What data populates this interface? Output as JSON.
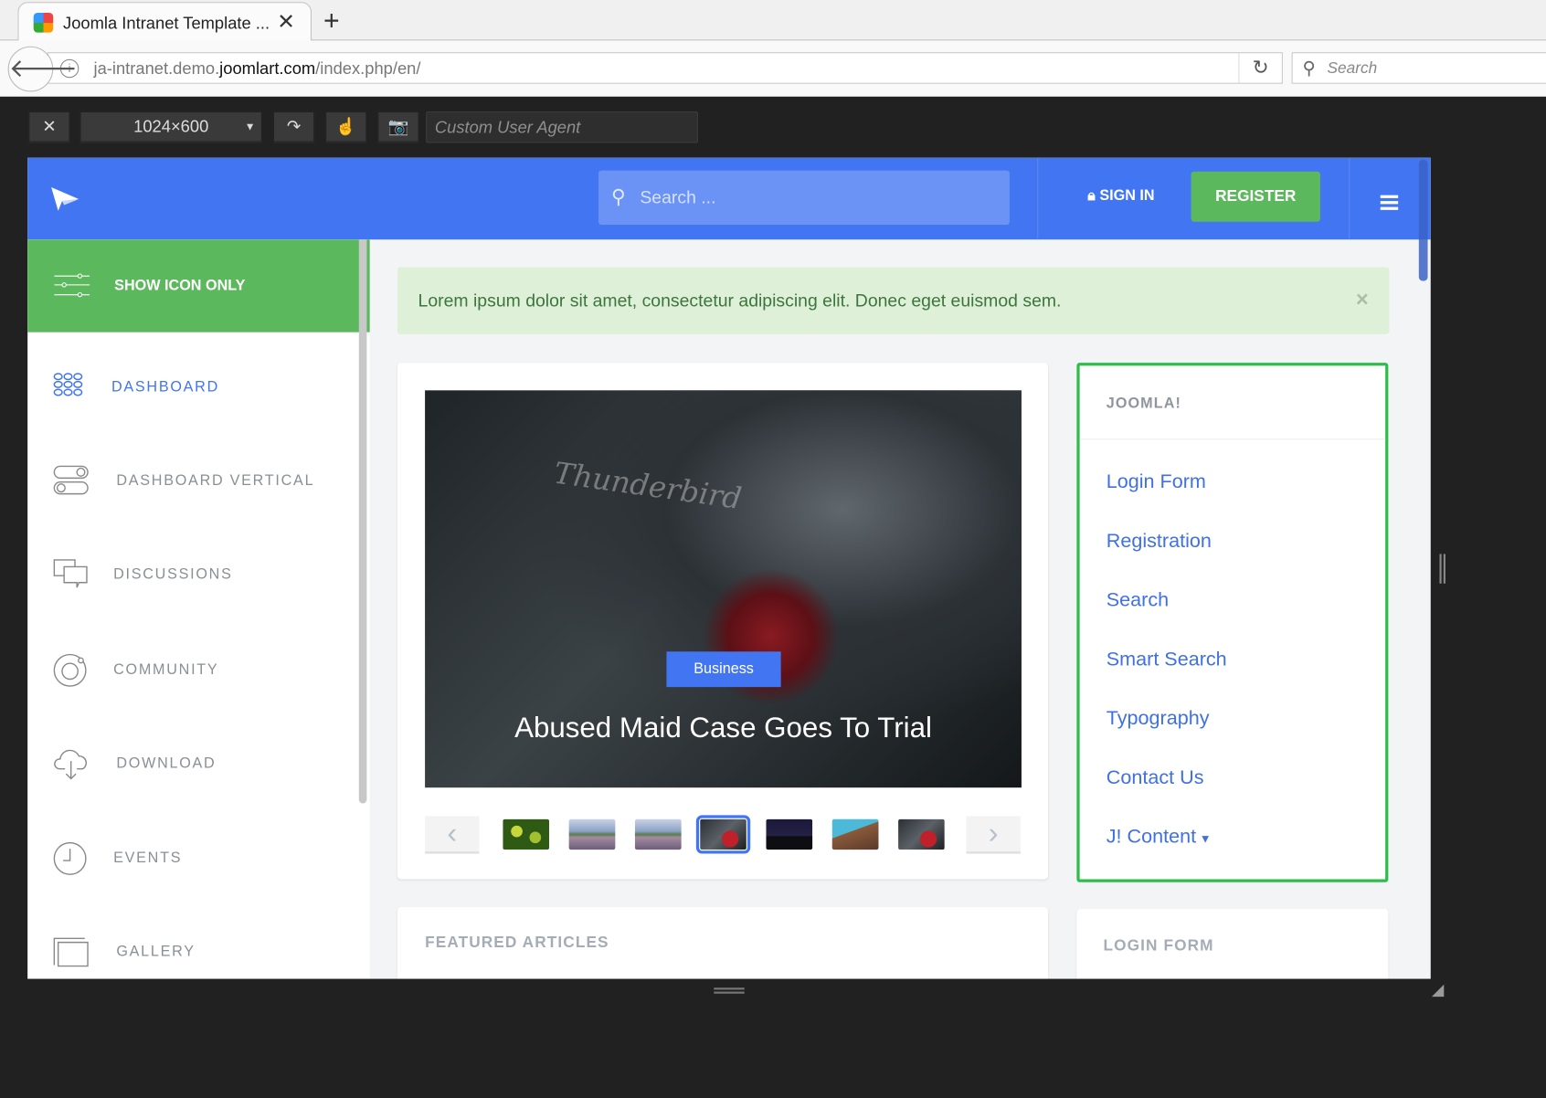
{
  "browser": {
    "tab_title": "Joomla Intranet Template ...",
    "url_host_prefix": "ja-intranet.demo.",
    "url_domain": "joomlart.com",
    "url_path": "/index.php/en/",
    "search_placeholder": "Search"
  },
  "devtools": {
    "viewport": "1024×600",
    "user_agent_placeholder": "Custom User Agent"
  },
  "header": {
    "search_placeholder": "Search ...",
    "sign_in": "SIGN IN",
    "register": "REGISTER"
  },
  "sidebar": {
    "toggle": "SHOW ICON ONLY",
    "items": [
      {
        "label": "DASHBOARD",
        "icon": "grid-icon",
        "active": true
      },
      {
        "label": "DASHBOARD VERTICAL",
        "icon": "toggles-icon"
      },
      {
        "label": "DISCUSSIONS",
        "icon": "chat-icon"
      },
      {
        "label": "COMMUNITY",
        "icon": "orbit-icon"
      },
      {
        "label": "DOWNLOAD",
        "icon": "cloud-download-icon"
      },
      {
        "label": "EVENTS",
        "icon": "clock-icon"
      },
      {
        "label": "GALLERY",
        "icon": "gallery-icon"
      }
    ]
  },
  "alert": {
    "text": "Lorem ipsum dolor sit amet, consectetur adipiscing elit. Donec eget euismod sem.",
    "close": "×"
  },
  "slider": {
    "category": "Business",
    "title": "Abused Maid Case Goes To Trial",
    "image_script": "Thunderbird",
    "selected_index": 3,
    "thumb_count": 7
  },
  "joomla_panel": {
    "heading": "JOOMLA!",
    "links": [
      "Login Form",
      "Registration",
      "Search",
      "Smart Search",
      "Typography",
      "Contact Us",
      "J! Content"
    ]
  },
  "featured": {
    "heading": "FEATURED ARTICLES"
  },
  "login": {
    "heading": "LOGIN FORM"
  },
  "colors": {
    "primary": "#4275f2",
    "success": "#5cb85c",
    "panel_border": "#2ebd4a",
    "alert_bg": "#dff0d8"
  }
}
